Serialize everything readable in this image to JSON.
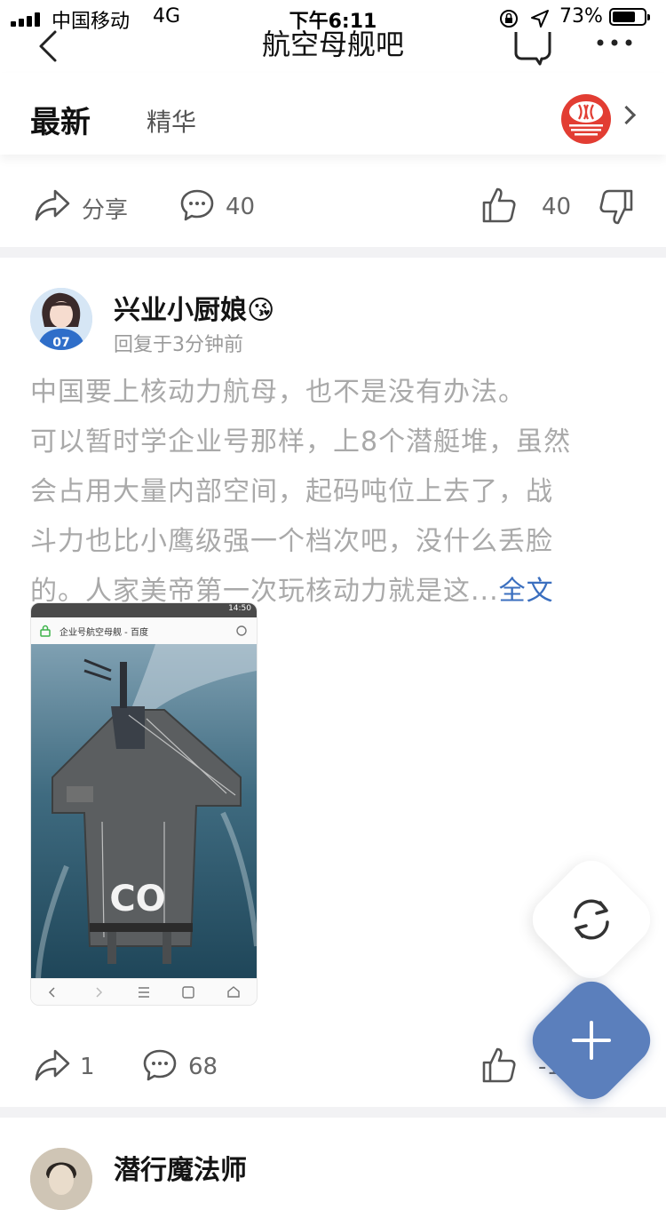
{
  "status_bar": {
    "carrier": "中国移动",
    "network": "4G",
    "time": "下午6:11",
    "battery_percent": "73%",
    "battery_level": 0.73
  },
  "nav": {
    "title": "航空母舰吧"
  },
  "tabs": {
    "active": "最新",
    "other": "精华"
  },
  "prev_post_actions": {
    "share_label": "分享",
    "comments": "40",
    "likes": "40"
  },
  "post": {
    "username": "兴业小厨娘",
    "username_emoji": "😘",
    "meta": "回复于3分钟前",
    "avatar_jersey": "07",
    "lines": [
      "中国要上核动力航母，也不是没有办法。",
      "可以暂时学企业号那样，上8个潜艇堆，虽然",
      "会占用大量内部空间，起码吨位上去了，战",
      "斗力也比小鹰级强一个档次吧，没什么丢脸",
      "的。人家美帝第一次玩核动力就是这..."
    ],
    "more_label": "全文",
    "thumb": {
      "status_time": "14:50",
      "url_text": "企业号航空母舰 - 百度",
      "deck_letters": "CO"
    },
    "actions": {
      "shares": "1",
      "comments": "68",
      "likes_partial": "-1"
    }
  },
  "next_post": {
    "username": "潜行魔法师"
  },
  "colors": {
    "accent_blue": "#3b6fbf",
    "fab_blue": "#5b7fbc",
    "logo_red": "#e23d33",
    "muted_text": "#a9a9a9"
  }
}
